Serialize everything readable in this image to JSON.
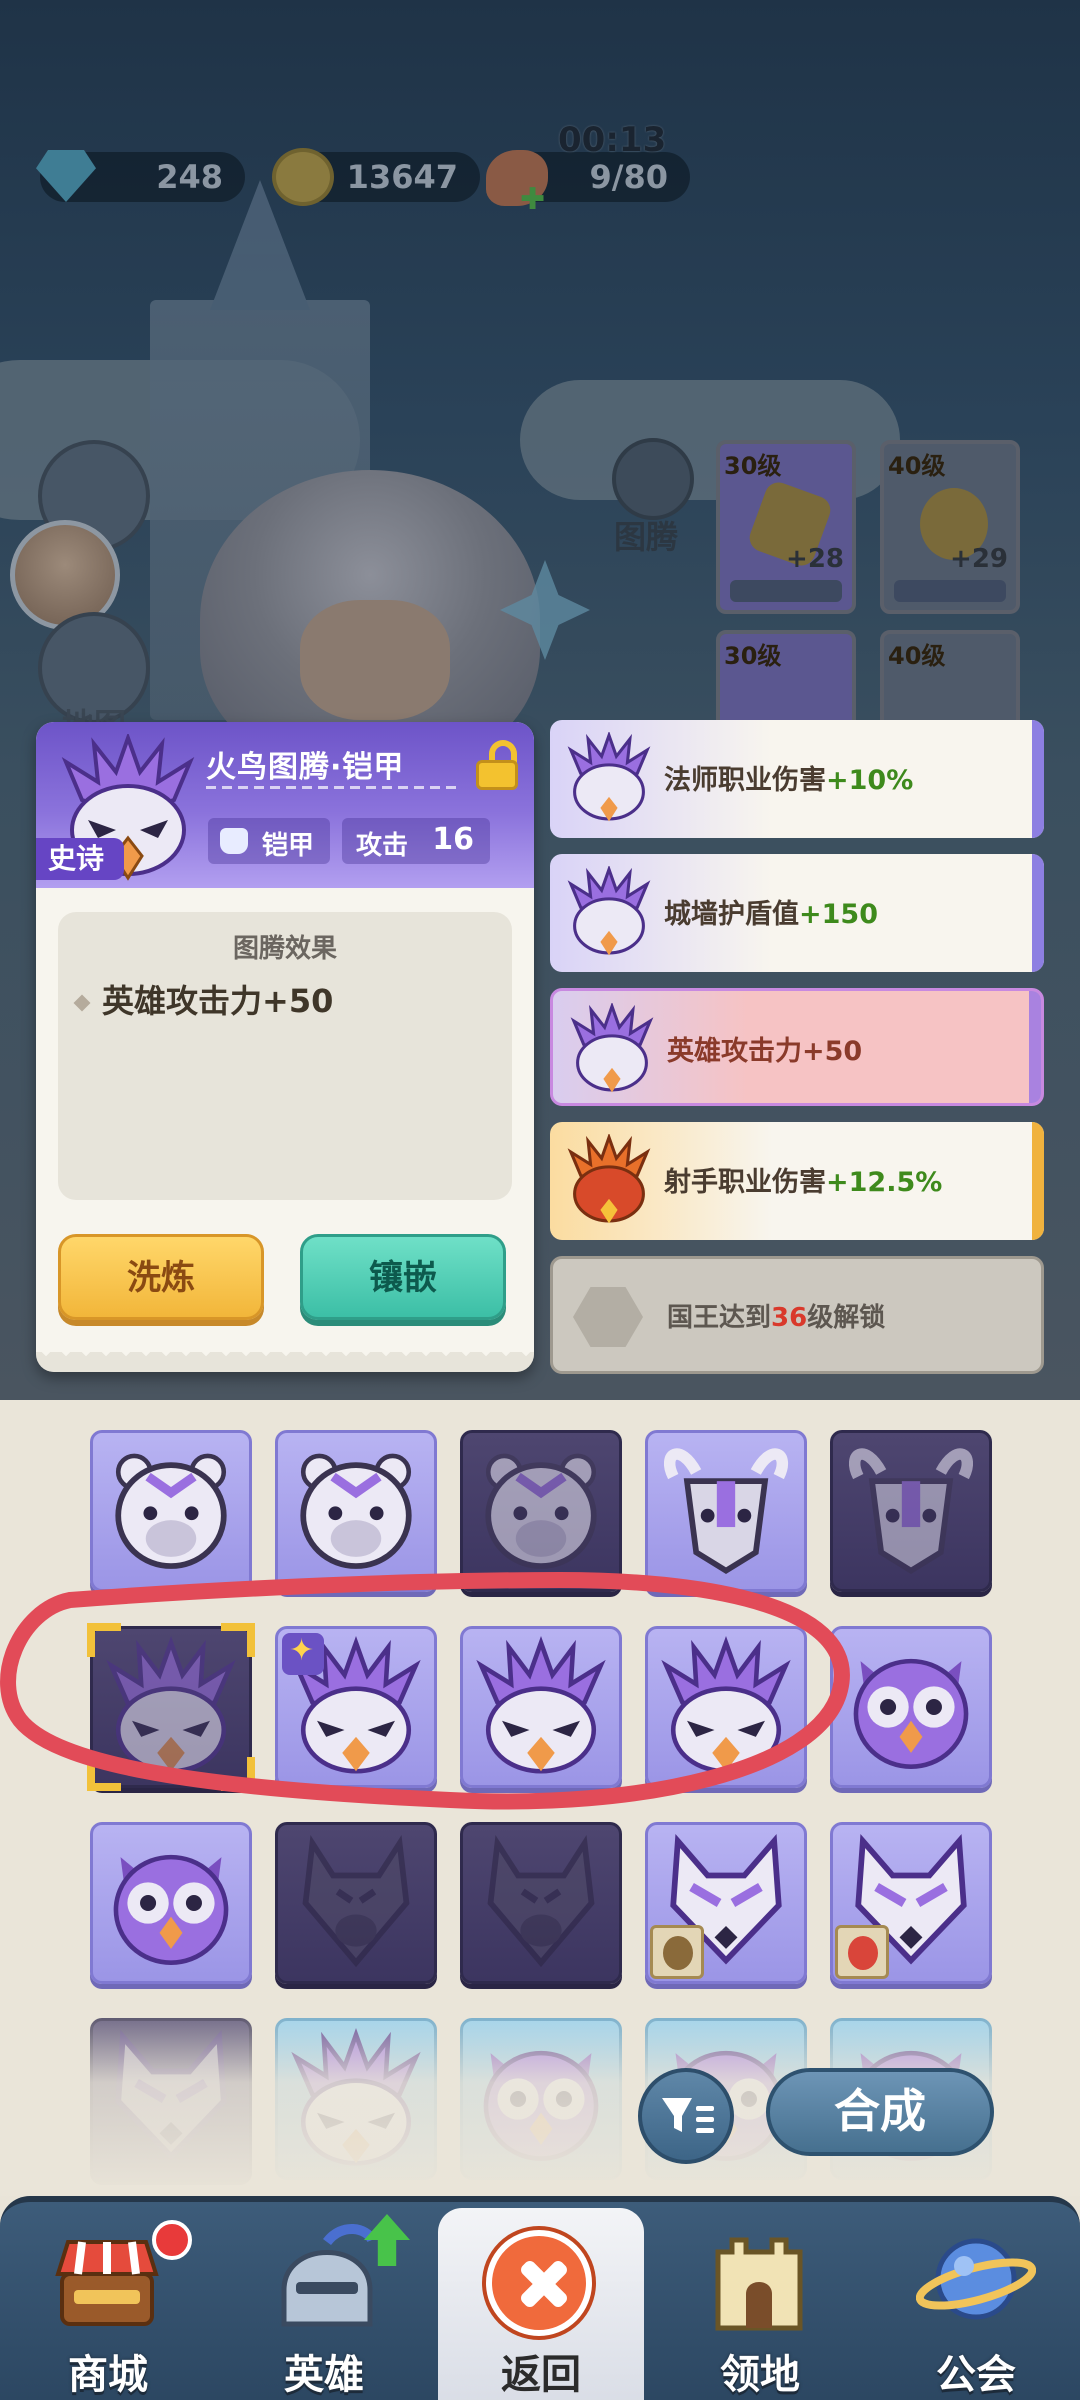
{
  "resources": {
    "gems": "248",
    "coins": "13647",
    "stamina": "9/80",
    "timer": "00:13"
  },
  "side": {
    "territory_label": "地图"
  },
  "totem_tab": {
    "label": "图腾"
  },
  "equipment": [
    {
      "level": "30级",
      "bonus": "+28"
    },
    {
      "level": "40级",
      "bonus": "+29"
    },
    {
      "level": "30级"
    },
    {
      "level": "40级"
    }
  ],
  "popup": {
    "name": "火鸟图腾·铠甲",
    "rarity": "史诗",
    "slot_type": "铠甲",
    "attack_label": "攻击",
    "attack_value": "16",
    "effect_title": "图腾效果",
    "effect_name": "英雄攻击力",
    "effect_value": "+50",
    "refine_label": "洗炼",
    "inlay_label": "镶嵌"
  },
  "slots": [
    {
      "label": "法师职业伤害",
      "value": "+10%"
    },
    {
      "label": "城墙护盾值",
      "value": "+150"
    },
    {
      "label": "英雄攻击力",
      "value": "+50"
    },
    {
      "label": "射手职业伤害",
      "value": "+12.5%"
    },
    {
      "prefix": "国王达到",
      "level": "36",
      "suffix": "级解锁"
    }
  ],
  "inventory": {
    "merge_label": "合成"
  },
  "nav": {
    "shop": "商城",
    "heroes": "英雄",
    "back": "返回",
    "territory": "领地",
    "guild": "公会"
  },
  "colors": {
    "epic_purple": "#6d54c8",
    "bonus_green": "#3e8a1c",
    "unlock_red": "#d9392b",
    "refine_yellow": "#f2b63a",
    "inlay_teal": "#3cbfa6",
    "annotation_red": "#e24b58"
  }
}
